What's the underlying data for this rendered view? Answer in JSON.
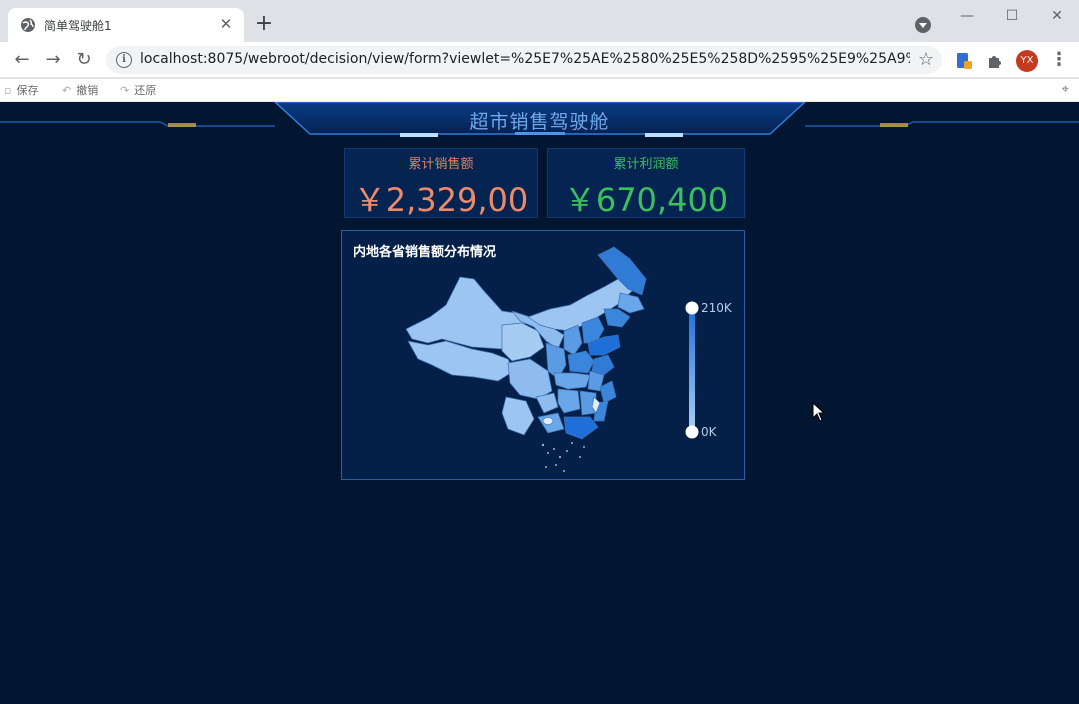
{
  "browser": {
    "tab_title": "简单驾驶舱1",
    "tab_close": "✕",
    "new_tab": "+",
    "url": "localhost:8075/webroot/decision/view/form?viewlet=%25E7%25AE%2580%25E5%258D%2595%25E9%25A9%25BE...",
    "avatar_initials": "YX",
    "window_controls": {
      "minimize": "—",
      "maximize": "☐",
      "close": "✕"
    }
  },
  "report_toolbar": {
    "save_label": "保存",
    "undo_label": "撤销",
    "redo_label": "还原"
  },
  "dashboard": {
    "title": "超市销售驾驶舱",
    "kpis": [
      {
        "label": "累计销售额",
        "value": "￥2,329,00",
        "color": "#ec8a6c"
      },
      {
        "label": "累计利润额",
        "value": "￥670,400",
        "color": "#3bbf5f"
      }
    ],
    "map_panel": {
      "title": "内地各省销售额分布情况",
      "visual_map": {
        "max_label": "210K",
        "min_label": "0K"
      }
    }
  },
  "colors": {
    "dashboard_bg": "#021632",
    "map_light": "#9cc5f1",
    "map_mid": "#5b9be3",
    "map_dark": "#1f6fd8",
    "accent": "#2f7bd6"
  }
}
